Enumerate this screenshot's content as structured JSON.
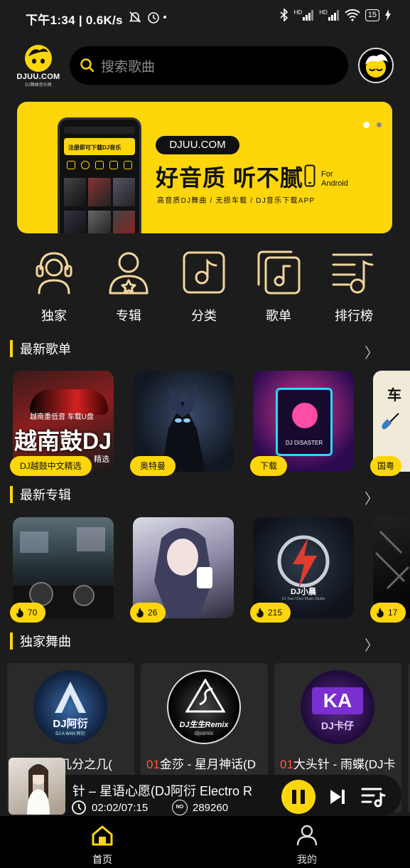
{
  "status": {
    "time": "下午1:34 | 0.6K/s",
    "battery": "15",
    "hd1": "HD",
    "hd2": "HD"
  },
  "logo": {
    "text": "DJUU.COM",
    "sub": "DJ舞曲音乐网"
  },
  "search": {
    "placeholder": "搜索歌曲"
  },
  "banner": {
    "domain": "DJUU.COM",
    "headline": "好音质 听不腻",
    "for": "For",
    "android": "Android",
    "tagline": "高音质DJ舞曲 / 无损车载 / DJ音乐下载APP",
    "phone_banner": "注册即可下载DJ音乐"
  },
  "categories": [
    "独家",
    "专辑",
    "分类",
    "歌单",
    "排行榜"
  ],
  "sections": {
    "playlists": "最新歌单",
    "albums": "最新专辑",
    "exclusive": "独家舞曲",
    "chevron": "〉"
  },
  "playlists": [
    {
      "tag": "DJ越鼓中文精选",
      "cover_top": "越南重低音 车载U盘",
      "cover_text": "越南鼓DJ",
      "cover_side": "精选"
    },
    {
      "tag": "奥特曼"
    },
    {
      "tag": "下载",
      "cover_text": "DJ DISASTER"
    },
    {
      "tag": "国粤",
      "cover_text": "车"
    }
  ],
  "albums": [
    {
      "count": "70"
    },
    {
      "count": "26"
    },
    {
      "count": "215",
      "cover_text": "DJ小晨",
      "cover_sub": "DJ Xiao Chen Music Studio"
    },
    {
      "count": "17"
    }
  ],
  "exclusive": [
    {
      "num": "",
      "title": "夏宇仲 - 几分之几(",
      "disc": "DJ阿衍",
      "disc_sub": "DJ A WAN 阿衍"
    },
    {
      "num": "01",
      "title": "金莎 - 星月神话(D",
      "disc": "DJ生生Remix",
      "disc_sub": "djssmix"
    },
    {
      "num": "01",
      "title": "大头针 - 雨蝶(DJ卡",
      "disc": "DJ卡仔"
    }
  ],
  "player": {
    "title": "针 – 星语心愿(DJ阿衍 Electro R",
    "time": "02:02/07:15",
    "no_label": "NO",
    "plays": "289260"
  },
  "nav": {
    "home": "首页",
    "mine": "我的"
  },
  "colors": {
    "accent": "#ffd60a",
    "bg": "#1c1c1c",
    "highlight": "#ff5a3c"
  }
}
